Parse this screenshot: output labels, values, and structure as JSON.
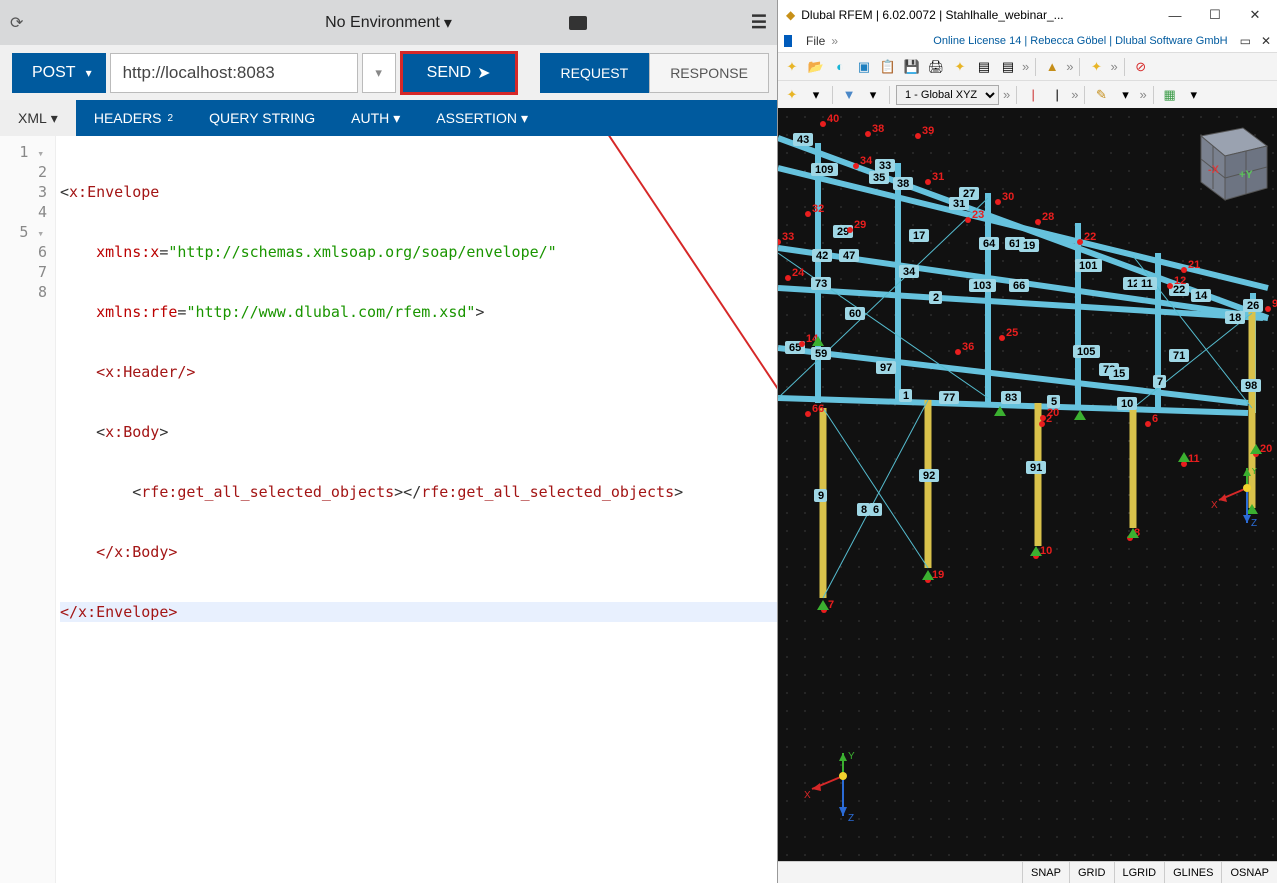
{
  "topbar": {
    "environment": "No Environment"
  },
  "request": {
    "method": "POST",
    "url": "http://localhost:8083",
    "send": "SEND",
    "tabs": {
      "request": "REQUEST",
      "response": "RESPONSE"
    }
  },
  "editorTabs": {
    "xml": "XML",
    "headers": "HEADERS",
    "headers_sup": "2",
    "query": "QUERY STRING",
    "auth": "AUTH",
    "assertion": "ASSERTION"
  },
  "gutter": [
    "1",
    "2",
    "3",
    "4",
    "5",
    "6",
    "7",
    "8"
  ],
  "xml": {
    "l1a": "<",
    "l1b": "x:Envelope",
    "l2a": "xmlns:x",
    "l2b": "=",
    "l2c": "\"http://schemas.xmlsoap.org/soap/envelope/\"",
    "l3a": "xmlns:rfe",
    "l3b": "=",
    "l3c": "\"http://www.dlubal.com/rfem.xsd\"",
    "l3d": ">",
    "l4": "<x:Header/>",
    "l5a": "<",
    "l5b": "x:Body",
    "l5c": ">",
    "l6a": "<",
    "l6b": "rfe:get_all_selected_objects",
    "l6c": "></",
    "l6d": "rfe:get_all_selected_objects",
    "l6e": ">",
    "l7": "</x:Body>",
    "l8": "</x:Envelope>"
  },
  "rfem": {
    "title": "Dlubal RFEM | 6.02.0072 | Stahlhalle_webinar_...",
    "file_menu": "File",
    "license": "Online License 14 | Rebecca Göbel | Dlubal Software GmbH",
    "coord_sys": "1 - Global XYZ",
    "navcube": {
      "xneg": "-X",
      "ypos": "+Y"
    },
    "axis": {
      "x": "X",
      "y": "Y",
      "z": "Z"
    },
    "status": [
      "SNAP",
      "GRID",
      "LGRID",
      "GLINES",
      "OSNAP"
    ],
    "members": [
      "43",
      "109",
      "33",
      "35",
      "38",
      "29",
      "31",
      "27",
      "42",
      "47",
      "34",
      "17",
      "64",
      "61",
      "19",
      "101",
      "73",
      "103",
      "66",
      "12",
      "11",
      "22",
      "14",
      "26",
      "60",
      "2",
      "105",
      "71",
      "18",
      "65",
      "59",
      "78",
      "15",
      "98",
      "97",
      "1",
      "77",
      "83",
      "5",
      "10",
      "7",
      "8",
      "6",
      "9",
      "92",
      "91"
    ],
    "nodes_red": [
      "40",
      "38",
      "39",
      "34",
      "32",
      "31",
      "33",
      "30",
      "29",
      "23",
      "28",
      "24",
      "22",
      "21",
      "25",
      "20",
      "14",
      "36",
      "12",
      "9",
      "66",
      "2",
      "6",
      "20",
      "19",
      "7",
      "8",
      "10",
      "11"
    ]
  }
}
